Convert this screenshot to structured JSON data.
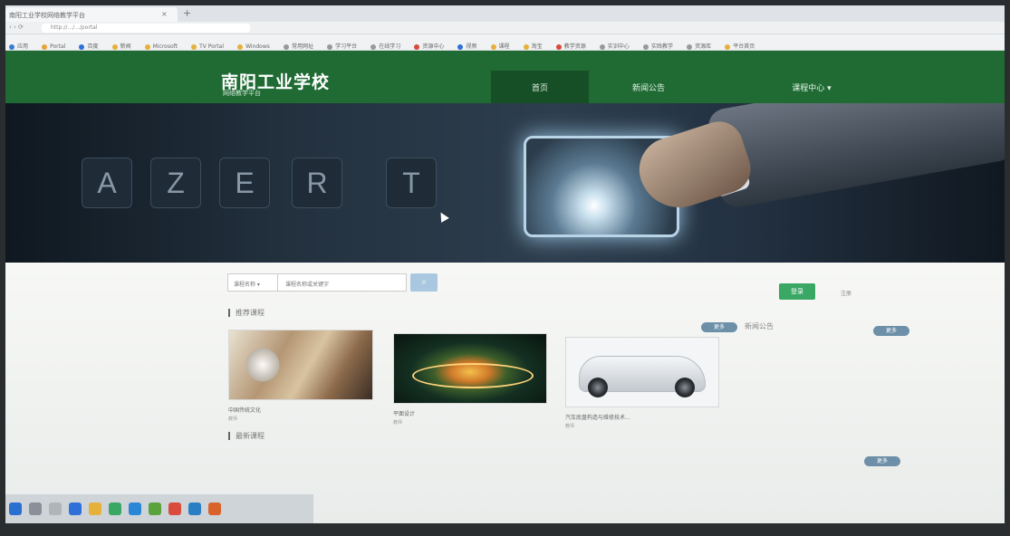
{
  "browser": {
    "tab_title": "南阳工业学校网络教学平台",
    "tab_close": "×",
    "tab_new": "+",
    "nav_glyphs": "‹ › ⟳",
    "url": "http://.../.../portal",
    "bookmarks": [
      "应用",
      "Portal",
      "百度",
      "新闻",
      "Microsoft",
      "TV Portal",
      "Windows",
      "常用网址",
      "学习平台",
      "在线学习",
      "资源中心",
      "视频",
      "课程",
      "淘宝",
      "教学资源",
      "实训中心",
      "实践教学",
      "资源库",
      "平台首页"
    ]
  },
  "site": {
    "title": "南阳工业学校",
    "subtitle": "网络教学平台",
    "nav": {
      "home": "首页",
      "notice": "新闻公告",
      "center": "课程中心 ▾"
    }
  },
  "banner": {
    "keys": [
      "A",
      "Z",
      "E",
      "R",
      "T"
    ]
  },
  "search": {
    "scope": "课程名称 ▾",
    "value": "课程名称或关键字",
    "button_icon": "⌕"
  },
  "auth": {
    "login": "登录",
    "register": "注册"
  },
  "sections": {
    "recommended": "推荐课程",
    "latest": "最新课程",
    "notice": "新闻公告",
    "more": "更多"
  },
  "courses": [
    {
      "name": "中国传统文化",
      "by": "教师"
    },
    {
      "name": "平面设计",
      "by": "教师"
    },
    {
      "name": "汽车底盘构造与维修技术...",
      "by": "教师"
    }
  ],
  "colors": {
    "header": "#1f6b33",
    "login": "#3aa864",
    "pill": "#6d8fa8",
    "search_button": "#a9c8e0"
  }
}
